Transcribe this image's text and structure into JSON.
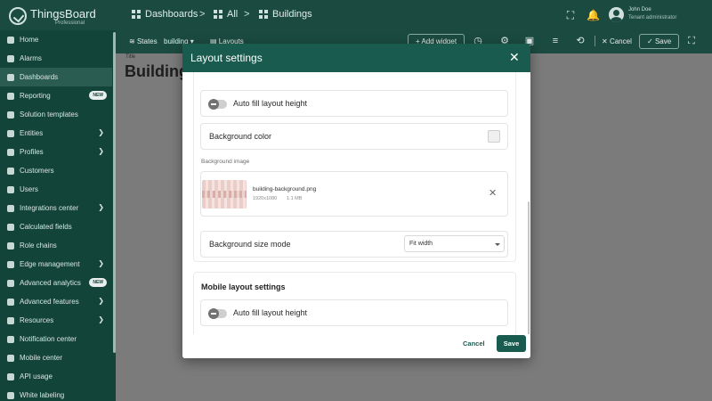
{
  "app": {
    "name": "ThingsBoard",
    "edition": "Professional"
  },
  "breadcrumb": [
    "Dashboards",
    "All",
    "Buildings"
  ],
  "breadcrumb_sep": ">",
  "user": {
    "name": "John Doe",
    "role": "Tenant administrator"
  },
  "sidebar": {
    "items": [
      {
        "label": "Home"
      },
      {
        "label": "Alarms"
      },
      {
        "label": "Dashboards",
        "active": true
      },
      {
        "label": "Reporting",
        "badge": "NEW"
      },
      {
        "label": "Solution templates"
      },
      {
        "label": "Entities",
        "expandable": true
      },
      {
        "label": "Profiles",
        "expandable": true
      },
      {
        "label": "Customers"
      },
      {
        "label": "Users"
      },
      {
        "label": "Integrations center",
        "expandable": true
      },
      {
        "label": "Calculated fields"
      },
      {
        "label": "Role chains"
      },
      {
        "label": "Edge management",
        "expandable": true
      },
      {
        "label": "Advanced analytics",
        "badge": "NEW"
      },
      {
        "label": "Advanced features",
        "expandable": true
      },
      {
        "label": "Resources",
        "expandable": true
      },
      {
        "label": "Notification center"
      },
      {
        "label": "Mobile center"
      },
      {
        "label": "API usage"
      },
      {
        "label": "White labeling"
      }
    ]
  },
  "toolbar": {
    "states_label": "States",
    "state_value": "building",
    "layouts_label": "Layouts",
    "add_widget_label": "+ Add widget",
    "cancel_label": "Cancel",
    "save_label": "Save"
  },
  "dashboard": {
    "title_label": "Title",
    "title": "Buildings"
  },
  "dialog": {
    "title": "Layout settings",
    "auto_fill_label": "Auto fill layout height",
    "background_color_label": "Background color",
    "background_image_label": "Background image",
    "file": {
      "name": "building-background.png",
      "resolution": "1920x1080",
      "size": "1.1 MB"
    },
    "background_size_mode_label": "Background size mode",
    "background_size_mode_value": "Fit width",
    "mobile_section_title": "Mobile layout settings",
    "mobile_auto_fill_label": "Auto fill layout height",
    "cancel_label": "Cancel",
    "save_label": "Save"
  }
}
